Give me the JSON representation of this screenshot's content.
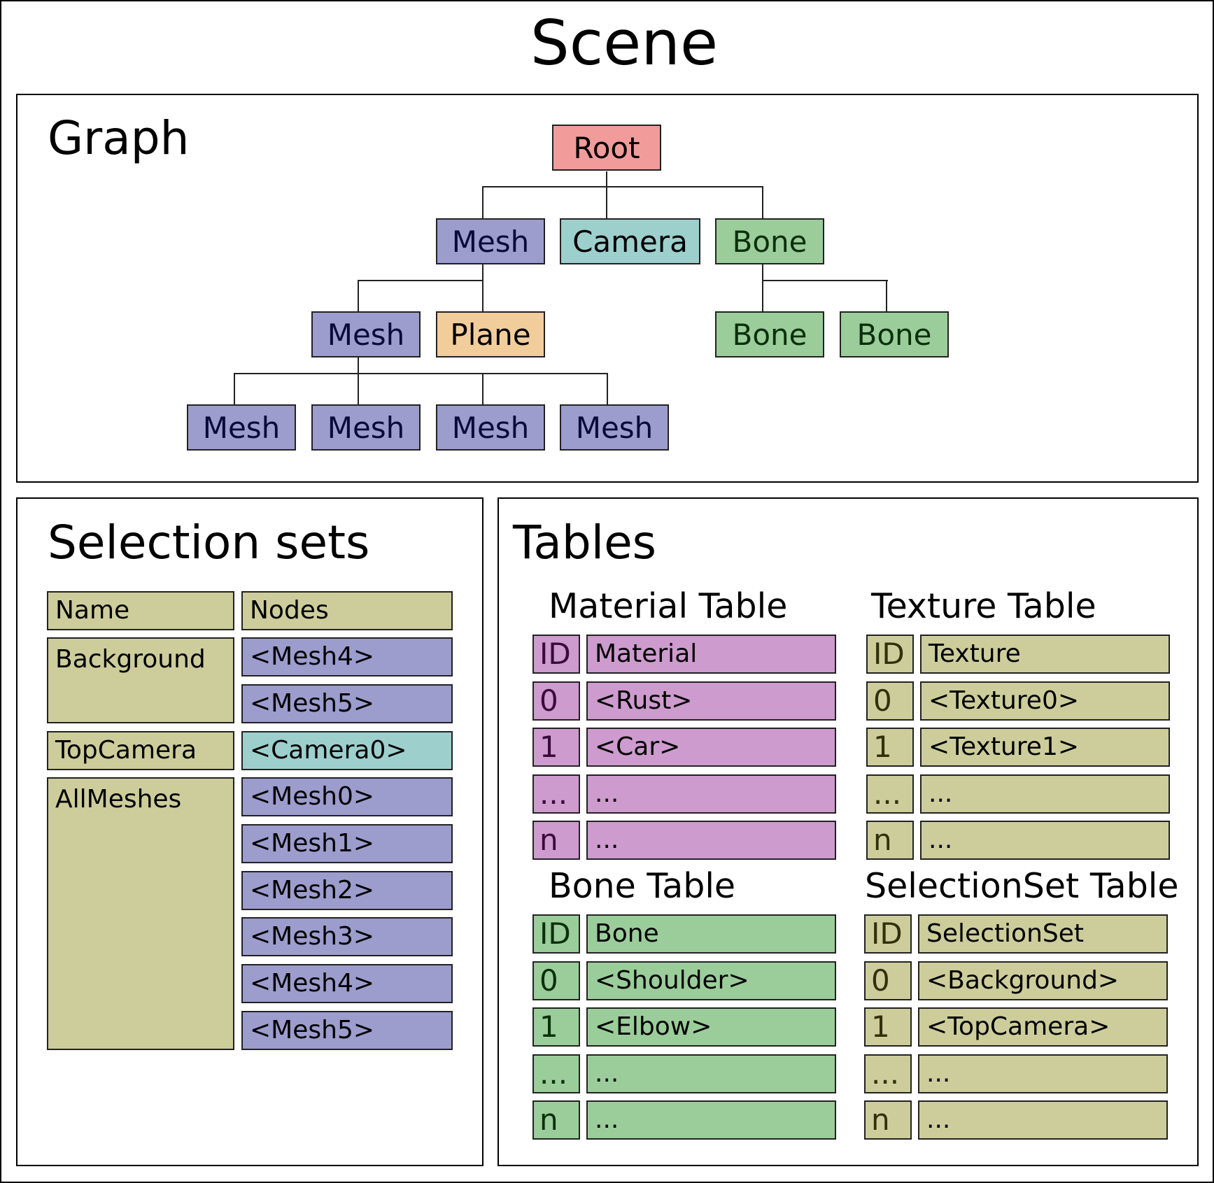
{
  "scene": {
    "title": "Scene"
  },
  "graph": {
    "title": "Graph",
    "nodes": {
      "root": "Root",
      "mesh_a": "Mesh",
      "camera": "Camera",
      "bone_a": "Bone",
      "mesh_b": "Mesh",
      "plane": "Plane",
      "bone_b": "Bone",
      "bone_c": "Bone",
      "mesh_c": "Mesh",
      "mesh_d": "Mesh",
      "mesh_e": "Mesh",
      "mesh_f": "Mesh"
    }
  },
  "selection_sets": {
    "title": "Selection sets",
    "header": {
      "name": "Name",
      "nodes": "Nodes"
    },
    "sets": [
      {
        "name": "Background",
        "nodes": [
          "<Mesh4>",
          "<Mesh5>"
        ]
      },
      {
        "name": "TopCamera",
        "nodes": [
          "<Camera0>"
        ]
      },
      {
        "name": "AllMeshes",
        "nodes": [
          "<Mesh0>",
          "<Mesh1>",
          "<Mesh2>",
          "<Mesh3>",
          "<Mesh4>",
          "<Mesh5>"
        ]
      }
    ]
  },
  "tables": {
    "title": "Tables",
    "material": {
      "title": "Material Table",
      "header": [
        "ID",
        "Material"
      ],
      "rows": [
        [
          "0",
          "<Rust>"
        ],
        [
          "1",
          "<Car>"
        ],
        [
          "...",
          "..."
        ],
        [
          "n",
          "..."
        ]
      ]
    },
    "texture": {
      "title": "Texture Table",
      "header": [
        "ID",
        "Texture"
      ],
      "rows": [
        [
          "0",
          "<Texture0>"
        ],
        [
          "1",
          "<Texture1>"
        ],
        [
          "...",
          "..."
        ],
        [
          "n",
          "..."
        ]
      ]
    },
    "bone": {
      "title": "Bone Table",
      "header": [
        "ID",
        "Bone"
      ],
      "rows": [
        [
          "0",
          "<Shoulder>"
        ],
        [
          "1",
          "<Elbow>"
        ],
        [
          "...",
          "..."
        ],
        [
          "n",
          "..."
        ]
      ]
    },
    "selectionset": {
      "title": "SelectionSet Table",
      "header": [
        "ID",
        "SelectionSet"
      ],
      "rows": [
        [
          "0",
          "<Background>"
        ],
        [
          "1",
          "<TopCamera>"
        ],
        [
          "...",
          "..."
        ],
        [
          "n",
          "..."
        ]
      ]
    }
  },
  "colors": {
    "root": "#f29b9b",
    "mesh": "#9c9ccd",
    "camera": "#9dcfcd",
    "bone": "#9bcd9b",
    "plane": "#f2cd9c",
    "set": "#cdcd9c",
    "material": "#cd9bcd",
    "mesh_text": "#0a0a3a",
    "bone_text": "#0a300a",
    "material_id_text": "#3a0a3a",
    "set_id_text": "#30300a"
  }
}
